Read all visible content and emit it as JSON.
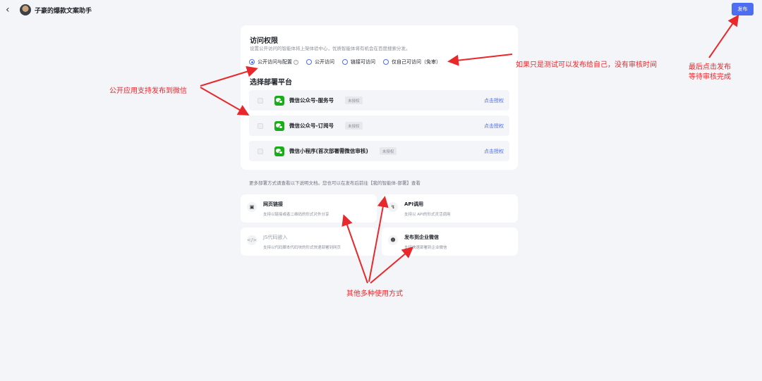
{
  "header": {
    "app_title": "子豪的爆款文案助手",
    "publish_label": "发布"
  },
  "access": {
    "title": "访问权限",
    "desc": "设置公开访问的智能体将上架体验中心，优质智能体将有机会在百度搜索分发。",
    "options": [
      {
        "label": "公开访问与配置",
        "selected": true
      },
      {
        "label": "公开访问",
        "selected": false
      },
      {
        "label": "链接可访问",
        "selected": false
      },
      {
        "label": "仅自己可访问（免审）",
        "selected": false
      }
    ]
  },
  "platforms": {
    "title": "选择部署平台",
    "items": [
      {
        "name": "微信公众号-服务号",
        "tag": "未授权",
        "action": "点击授权"
      },
      {
        "name": "微信公众号-订阅号",
        "tag": "未授权",
        "action": "点击授权"
      },
      {
        "name": "微信小程序(首次部署需微信审核)",
        "tag": "未授权",
        "action": "点击授权"
      }
    ]
  },
  "more_tip": "更多部署方式请查看以下说明文档。您也可以在发布后前往【我的智能体-部署】查看",
  "cards": [
    {
      "title": "网页链接",
      "desc": "支持以链接或者二维码的形式对外分享",
      "icon": "browser-icon"
    },
    {
      "title": "API调用",
      "desc": "支持以 API的形式灵活调用",
      "icon": "plug-icon"
    },
    {
      "title": "JS代码嵌入",
      "desc": "支持以代码脚本代码块的形式快速部署到网页",
      "icon": "code-icon"
    },
    {
      "title": "发布到企业微信",
      "desc": "支持快速部署到企业微信",
      "icon": "robot-icon"
    }
  ],
  "annotations": {
    "wechat": "公开应用支持发布到微信",
    "self": "如果只是测试可以发布给自己，没有审核时间",
    "publish_line1": "最后点击发布",
    "publish_line2": "等待审核完成",
    "others": "其他多种使用方式"
  },
  "colors": {
    "accent": "#4e6ef2",
    "annotation": "#e8282b",
    "wechat_green": "#1aad19"
  }
}
